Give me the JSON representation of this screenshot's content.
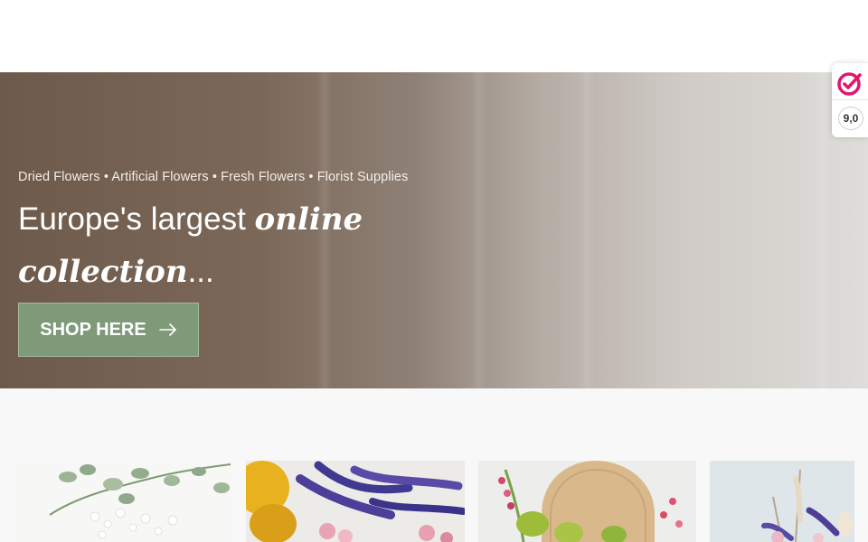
{
  "hero": {
    "kicker": "Dried Flowers • Artificial Flowers • Fresh Flowers • Florist Supplies",
    "headline_plain": "Europe's largest ",
    "headline_script_1": "online",
    "headline_script_2": "collection",
    "headline_end": "...",
    "cta_label": "SHOP HERE",
    "cta_icon": "arrow-right-icon"
  },
  "trust_badge": {
    "logo_icon": "trusted-shops-check-icon",
    "score": "9,0"
  },
  "categories": [
    {
      "image": "eucalyptus-gypsophila-photo"
    },
    {
      "image": "blue-larkspur-bouquet-photo"
    },
    {
      "image": "pink-flowers-vase-photo"
    },
    {
      "image": "pastel-dried-bouquet-photo"
    }
  ],
  "colors": {
    "cta_green": "#7e9a78",
    "hero_brown": "#6e5a4b",
    "trust_pink": "#e2156f"
  }
}
